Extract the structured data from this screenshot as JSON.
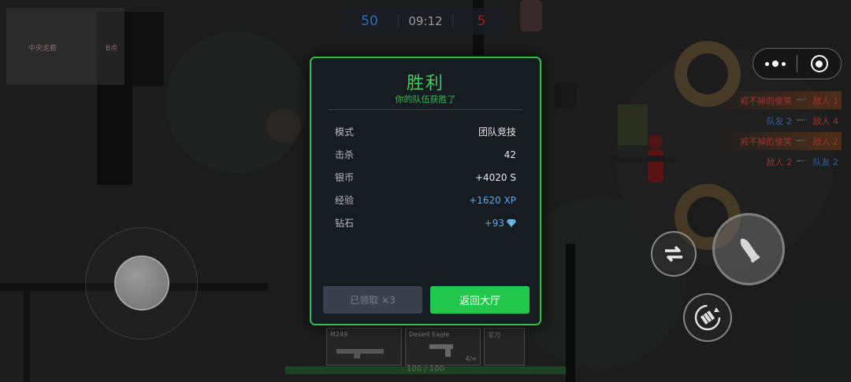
{
  "hud": {
    "score_blue": "50",
    "timer": "09:12",
    "score_red": "5",
    "health_text": "100 / 100"
  },
  "minimap": {
    "label_left": "中央走廊",
    "label_right": "B点"
  },
  "killfeed": [
    {
      "killer": "戒不掉的傻笑",
      "killer_team": "red",
      "weapon_icon": "rifle-icon",
      "victim": "敌人 1",
      "victim_team": "red",
      "highlight": true
    },
    {
      "killer": "队友 2",
      "killer_team": "blue",
      "weapon_icon": "rifle-icon",
      "victim": "敌人 4",
      "victim_team": "red",
      "highlight": false
    },
    {
      "killer": "戒不掉的傻笑",
      "killer_team": "red",
      "weapon_icon": "rifle-icon",
      "victim": "敌人 2",
      "victim_team": "red",
      "highlight": true
    },
    {
      "killer": "敌人 2",
      "killer_team": "red",
      "weapon_icon": "rifle-icon",
      "victim": "队友 2",
      "victim_team": "blue",
      "highlight": false
    }
  ],
  "weapons": [
    {
      "name": "M249",
      "ammo": ""
    },
    {
      "name": "Desert Eagle",
      "ammo": "4/∞"
    },
    {
      "name": "军刀",
      "ammo": ""
    }
  ],
  "result": {
    "title": "胜利",
    "subtitle": "你的队伍获胜了",
    "stats": [
      {
        "label": "模式",
        "value": "团队竞技",
        "style": "plain"
      },
      {
        "label": "击杀",
        "value": "42",
        "style": "plain"
      },
      {
        "label": "银币",
        "value": "+4020 S",
        "style": "plain"
      },
      {
        "label": "经验",
        "value": "+1620 XP",
        "style": "xp"
      },
      {
        "label": "钻石",
        "value": "+93",
        "style": "gem",
        "icon": "diamond-icon"
      }
    ],
    "claimed_label": "已领取 ×3",
    "lobby_label": "返回大厅"
  },
  "colors": {
    "accent_green": "#2fbe4a",
    "button_green": "#22c84a",
    "xp_blue": "#58a9e8",
    "team_blue": "#2b6fb8",
    "team_red": "#a02020"
  }
}
